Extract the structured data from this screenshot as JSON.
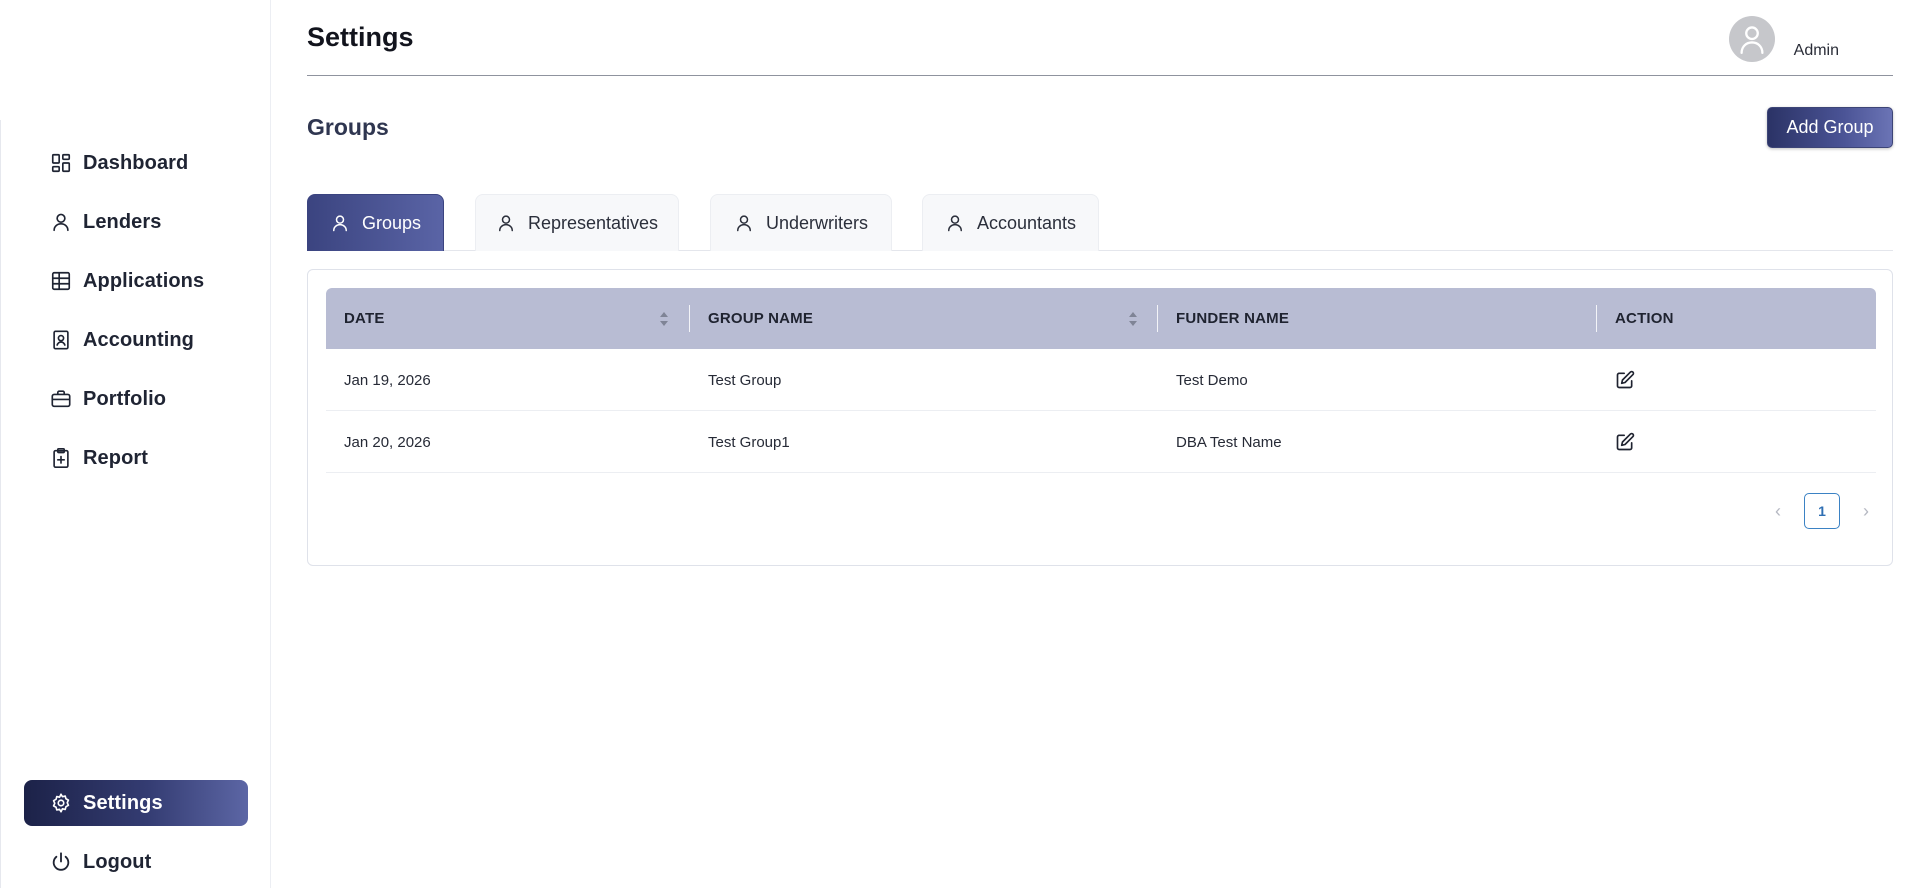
{
  "sidebar": {
    "items": [
      {
        "label": "Dashboard",
        "icon": "dashboard-icon"
      },
      {
        "label": "Lenders",
        "icon": "user-icon"
      },
      {
        "label": "Applications",
        "icon": "grid-icon"
      },
      {
        "label": "Accounting",
        "icon": "contact-book-icon"
      },
      {
        "label": "Portfolio",
        "icon": "briefcase-icon"
      },
      {
        "label": "Report",
        "icon": "clipboard-plus-icon"
      }
    ],
    "bottom": [
      {
        "label": "Settings",
        "icon": "gear-icon",
        "active": true
      },
      {
        "label": "Logout",
        "icon": "power-icon"
      }
    ]
  },
  "header": {
    "title": "Settings",
    "user_name": "Admin"
  },
  "section": {
    "title": "Groups",
    "add_button": "Add Group"
  },
  "tabs": [
    {
      "label": "Groups",
      "active": true
    },
    {
      "label": "Representatives"
    },
    {
      "label": "Underwriters"
    },
    {
      "label": "Accountants"
    }
  ],
  "table": {
    "columns": [
      "DATE",
      "GROUP NAME",
      "FUNDER NAME",
      "ACTION"
    ],
    "rows": [
      {
        "date": "Jan 19, 2026",
        "group_name": "Test Group",
        "funder_name": "Test Demo"
      },
      {
        "date": "Jan 20, 2026",
        "group_name": "Test Group1",
        "funder_name": "DBA Test Name"
      }
    ]
  },
  "pagination": {
    "current_page": "1",
    "prev": "‹",
    "next": "›"
  },
  "colors": {
    "accent_dark": "#1c2248",
    "accent": "#4a5395",
    "table_header": "#b8bcd3",
    "page_link": "#2f6fb3"
  }
}
